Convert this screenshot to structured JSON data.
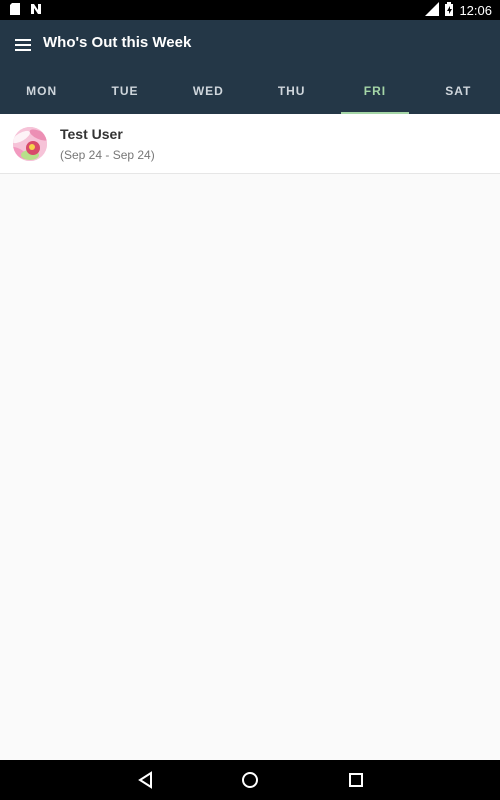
{
  "status_bar": {
    "time": "12:06",
    "icons": [
      "sd-card-icon",
      "notification-n-icon",
      "lte-signal-icon",
      "battery-charging-icon"
    ]
  },
  "app_bar": {
    "title": "Who's Out this Week",
    "menu_icon": "hamburger-menu-icon",
    "background": "#243747"
  },
  "tabs": [
    {
      "label": "MON",
      "active": false
    },
    {
      "label": "TUE",
      "active": false
    },
    {
      "label": "WED",
      "active": false
    },
    {
      "label": "THU",
      "active": false
    },
    {
      "label": "FRI",
      "active": true
    },
    {
      "label": "SAT",
      "active": false
    }
  ],
  "accent_color": "#a5d6a7",
  "list": {
    "items": [
      {
        "name": "Test User",
        "dates": "(Sep 24 - Sep 24)",
        "avatar_icon": "flower-avatar"
      }
    ]
  },
  "nav_bar": {
    "icons": [
      "back-icon",
      "home-icon",
      "recents-icon"
    ]
  }
}
